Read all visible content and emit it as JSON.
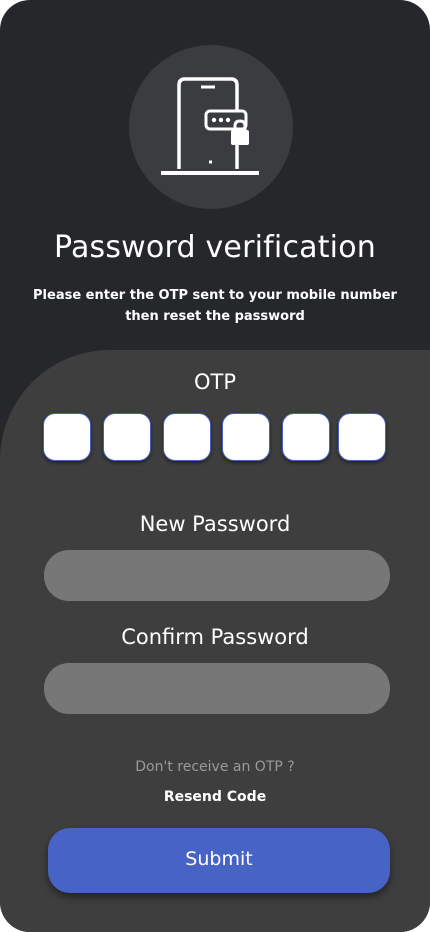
{
  "header": {
    "icon": "phone-lock-icon",
    "title": "Password verification",
    "subtitle_line1": "Please enter the OTP sent to your mobile number",
    "subtitle_line2": "then reset the password"
  },
  "otp": {
    "label": "OTP",
    "digits": [
      "",
      "",
      "",
      "",
      "",
      ""
    ]
  },
  "new_password": {
    "label": "New Password",
    "value": "",
    "placeholder": ""
  },
  "confirm_password": {
    "label": "Confirm Password",
    "value": "",
    "placeholder": ""
  },
  "resend": {
    "prompt": "Don't receive an OTP ?",
    "link": "Resend Code"
  },
  "submit_label": "Submit",
  "colors": {
    "background": "#26272b",
    "panel": "#3e3e3e",
    "accent": "#4863c6",
    "input": "#777777"
  }
}
